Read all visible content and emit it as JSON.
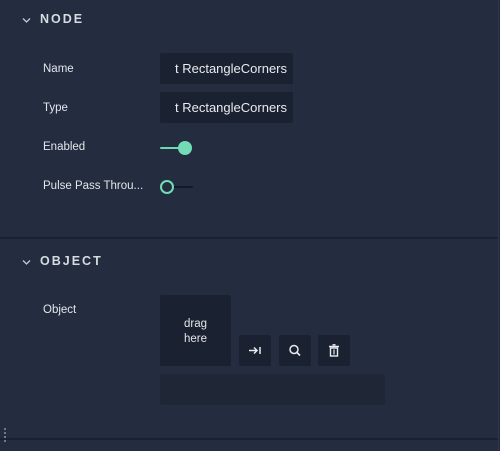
{
  "sections": {
    "node": {
      "title": "NODE",
      "fields": {
        "name_label": "Name",
        "name_value": "t RectangleCorners",
        "type_label": "Type",
        "type_value": "t RectangleCorners",
        "enabled_label": "Enabled",
        "enabled": true,
        "pulse_label": "Pulse Pass Throu...",
        "pulse": false
      }
    },
    "object": {
      "title": "OBJECT",
      "fields": {
        "object_label": "Object",
        "drop_line1": "drag",
        "drop_line2": "here",
        "secondary_value": ""
      },
      "buttons": [
        {
          "name": "assign-button",
          "icon": "arrow-to-line-icon"
        },
        {
          "name": "find-button",
          "icon": "search-icon"
        },
        {
          "name": "delete-button",
          "icon": "trash-icon"
        }
      ]
    }
  },
  "colors": {
    "accent": "#73dcb6",
    "panel": "#232d3f",
    "field": "#1a2130"
  }
}
